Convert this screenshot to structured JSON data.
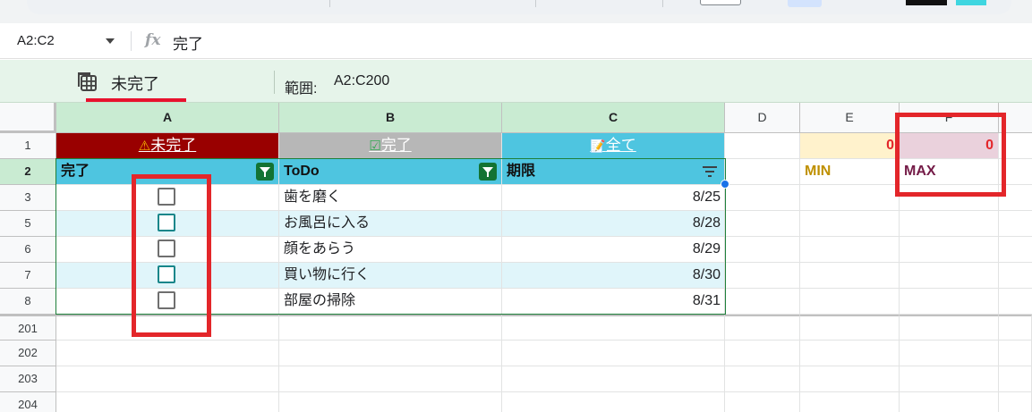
{
  "formula_bar": {
    "name_box": "A2:C2",
    "fx_label": "fx",
    "value": "完了"
  },
  "filter_view": {
    "name": "未完了",
    "range_label": "範囲:",
    "range_value": "A2:C200"
  },
  "columns": [
    "A",
    "B",
    "C",
    "D",
    "E",
    "F"
  ],
  "row_numbers": [
    "1",
    "2",
    "3",
    "5",
    "6",
    "7",
    "8",
    "201",
    "202",
    "203",
    "204"
  ],
  "row1": {
    "a": "未完了",
    "a_icon": "⚠",
    "b": "完了",
    "b_icon": "☑",
    "c": "全て",
    "c_icon": "📝",
    "e": "0",
    "f": "0"
  },
  "row2": {
    "a": "完了",
    "b": "ToDo",
    "c": "期限",
    "e": "MIN",
    "f": "MAX"
  },
  "tasks": [
    {
      "todo": "歯を磨く",
      "due": "8/25",
      "checked": false
    },
    {
      "todo": "お風呂に入る",
      "due": "8/28",
      "checked": false
    },
    {
      "todo": "顔をあらう",
      "due": "8/29",
      "checked": false
    },
    {
      "todo": "買い物に行く",
      "due": "8/30",
      "checked": false
    },
    {
      "todo": "部屋の掃除",
      "due": "8/31",
      "checked": false
    }
  ],
  "colors": {
    "row1_a_bg": "#990000",
    "row1_b_bg": "#b7b7b7",
    "row1_c_bg": "#4ec5e0",
    "header_bg": "#4ec5e0",
    "band_bg": "#e0f5fa",
    "min_bg": "#fff2cc",
    "max_bg": "#ead1dc",
    "min_color": "#bf9000",
    "max_color": "#741b47",
    "highlight_red": "#e3262a"
  }
}
